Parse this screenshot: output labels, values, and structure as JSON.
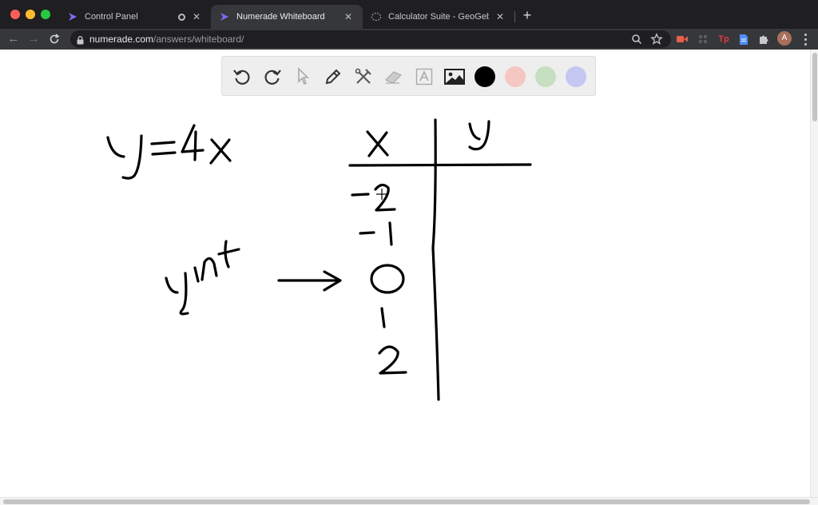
{
  "browser": {
    "tabs": [
      {
        "title": "Control Panel",
        "active": false
      },
      {
        "title": "Numerade Whiteboard",
        "active": true
      },
      {
        "title": "Calculator Suite - GeoGebra",
        "active": false
      }
    ],
    "url_domain": "numerade.com",
    "url_path": "/answers/whiteboard/",
    "avatar_initial": "A",
    "ext_tp_label": "Tp"
  },
  "whiteboard": {
    "tools": [
      "undo-icon",
      "redo-icon",
      "pointer-icon",
      "pen-icon",
      "tools-icon",
      "eraser-icon",
      "text-icon",
      "image-icon"
    ],
    "colors": [
      "#000000",
      "#f4c7c3",
      "#c5dfc0",
      "#c3c7f2"
    ]
  }
}
